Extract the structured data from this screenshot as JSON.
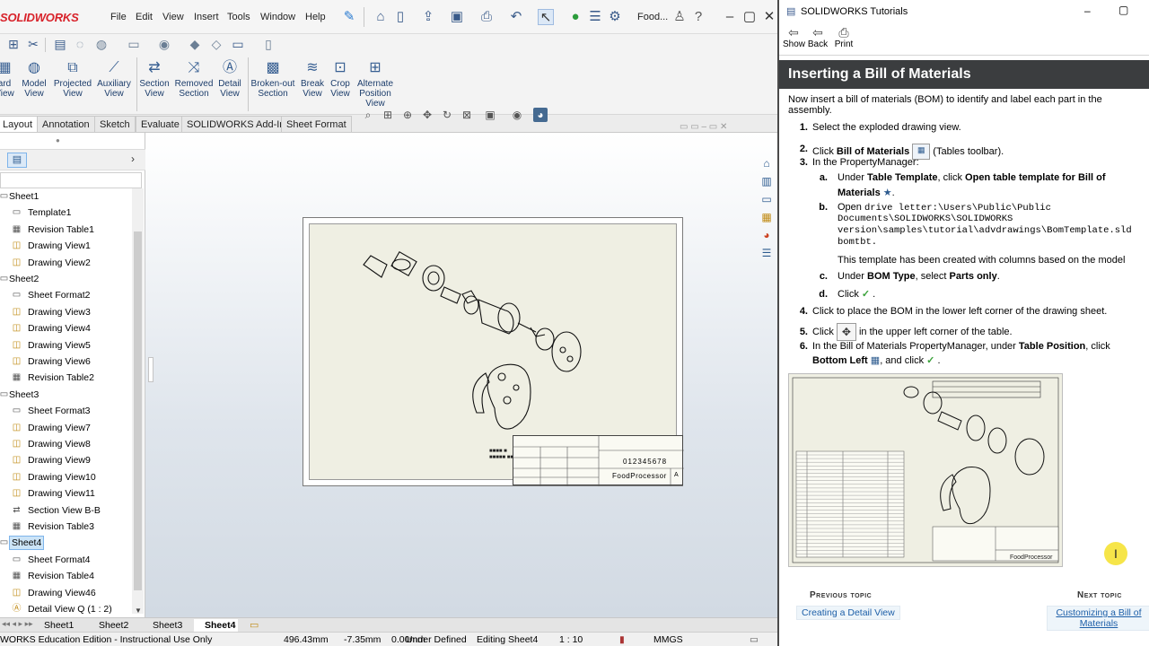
{
  "sw": {
    "logo": "SOLIDWORKS",
    "menus": [
      "File",
      "Edit",
      "View",
      "Insert",
      "Tools",
      "Window",
      "Help"
    ],
    "doc_title": "Food...",
    "ribbon": [
      {
        "label": "ard\nView",
        "icon": "standard-3-view-icon"
      },
      {
        "label": "Model\nView",
        "icon": "model-view-icon"
      },
      {
        "label": "Projected\nView",
        "icon": "projected-view-icon"
      },
      {
        "label": "Auxiliary\nView",
        "icon": "auxiliary-view-icon"
      },
      {
        "label": "Section\nView",
        "icon": "section-view-icon"
      },
      {
        "label": "Removed\nSection",
        "icon": "removed-section-icon"
      },
      {
        "label": "Detail\nView",
        "icon": "detail-view-icon"
      },
      {
        "label": "Broken-out\nSection",
        "icon": "broken-out-section-icon"
      },
      {
        "label": "Break\nView",
        "icon": "break-view-icon"
      },
      {
        "label": "Crop\nView",
        "icon": "crop-view-icon"
      },
      {
        "label": "Alternate\nPosition\nView",
        "icon": "alternate-position-view-icon"
      }
    ],
    "tabs": [
      "Layout",
      "Annotation",
      "Sketch",
      "Evaluate",
      "SOLIDWORKS Add-Ins",
      "Sheet Format"
    ],
    "tree": [
      {
        "label": "Sheet1",
        "level": 0,
        "icon": "sheet-icon"
      },
      {
        "label": "Template1",
        "level": 1,
        "icon": "sheet-format-icon"
      },
      {
        "label": "Revision Table1",
        "level": 1,
        "icon": "revision-table-icon"
      },
      {
        "label": "Drawing View1",
        "level": 1,
        "icon": "drawing-view-icon"
      },
      {
        "label": "Drawing View2",
        "level": 1,
        "icon": "drawing-view-icon"
      },
      {
        "label": "Sheet2",
        "level": 0,
        "icon": "sheet-icon"
      },
      {
        "label": "Sheet Format2",
        "level": 1,
        "icon": "sheet-format-icon"
      },
      {
        "label": "Drawing View3",
        "level": 1,
        "icon": "drawing-view-icon"
      },
      {
        "label": "Drawing View4",
        "level": 1,
        "icon": "drawing-view-icon"
      },
      {
        "label": "Drawing View5",
        "level": 1,
        "icon": "drawing-view-icon"
      },
      {
        "label": "Drawing View6",
        "level": 1,
        "icon": "drawing-view-icon"
      },
      {
        "label": "Revision Table2",
        "level": 1,
        "icon": "revision-table-icon"
      },
      {
        "label": "Sheet3",
        "level": 0,
        "icon": "sheet-icon"
      },
      {
        "label": "Sheet Format3",
        "level": 1,
        "icon": "sheet-format-icon"
      },
      {
        "label": "Drawing View7",
        "level": 1,
        "icon": "drawing-view-icon"
      },
      {
        "label": "Drawing View8",
        "level": 1,
        "icon": "drawing-view-icon"
      },
      {
        "label": "Drawing View9",
        "level": 1,
        "icon": "drawing-view-icon"
      },
      {
        "label": "Drawing View10",
        "level": 1,
        "icon": "drawing-view-icon"
      },
      {
        "label": "Drawing View11",
        "level": 1,
        "icon": "drawing-view-icon"
      },
      {
        "label": "Section View B-B",
        "level": 1,
        "icon": "section-view-icon"
      },
      {
        "label": "Revision Table3",
        "level": 1,
        "icon": "revision-table-icon"
      },
      {
        "label": "Sheet4",
        "level": 0,
        "icon": "sheet-icon",
        "selected": true
      },
      {
        "label": "Sheet Format4",
        "level": 1,
        "icon": "sheet-format-icon"
      },
      {
        "label": "Revision Table4",
        "level": 1,
        "icon": "revision-table-icon"
      },
      {
        "label": "Drawing View46",
        "level": 1,
        "icon": "drawing-view-icon"
      },
      {
        "label": "Detail View Q (1 : 2)",
        "level": 1,
        "icon": "detail-view-icon"
      }
    ],
    "title_block": {
      "part_no": "012345678",
      "name": "FoodProcessor",
      "size": "A"
    },
    "sheet_tabs": [
      "Sheet1",
      "Sheet2",
      "Sheet3",
      "Sheet4"
    ],
    "active_sheet": "Sheet4",
    "status": {
      "edition": "WORKS Education Edition - Instructional Use Only",
      "x": "496.43mm",
      "y": "-7.35mm",
      "z": "0.00mm",
      "state": "Under Defined",
      "editing": "Editing Sheet4",
      "scale": "1 : 10",
      "units": "MMGS"
    }
  },
  "tutorial": {
    "window_title": "SOLIDWORKS Tutorials",
    "tools": [
      "Show",
      "Back",
      "Print"
    ],
    "heading": "Inserting a Bill of Materials",
    "intro_1": "Now insert a bill of materials (BOM) to identify and label each part in the",
    "intro_2": "assembly.",
    "s1": "Select the exploded drawing view.",
    "s2_pre": "Click ",
    "s2_bold": "Bill of Materials",
    "s2_post": " (Tables toolbar).",
    "s3": "In the PropertyManager:",
    "s3a_pre": "Under ",
    "s3a_bold1": "Table Template",
    "s3a_mid": ", click ",
    "s3a_bold2": "Open table template for Bill of",
    "s3a_bold3": "Materials",
    "s3b_pre": "Open ",
    "s3b_l1": "drive letter:\\Users\\Public\\Public",
    "s3b_l2": "Documents\\SOLIDWORKS\\SOLIDWORKS",
    "s3b_l3": "version\\samples\\tutorial\\advdrawings\\BomTemplate.sld",
    "s3b_l4": "bomtbt.",
    "s3b_note": "This template has been created with columns based on the model",
    "s3c_pre": "Under ",
    "s3c_bold1": "BOM Type",
    "s3c_mid": ", select ",
    "s3c_bold2": "Parts only",
    "s3c_post": ".",
    "s3d": "Click",
    "s4": "Click to place the BOM in the lower left corner of the drawing sheet.",
    "s5_pre": "Click",
    "s5_post": "in the upper left corner of the table.",
    "s6_l1_pre": "In the Bill of Materials PropertyManager, under ",
    "s6_l1_bold": "Table Position",
    "s6_l1_post": ", click",
    "s6_l2_bold": "Bottom Left",
    "s6_l2_post": ", and click",
    "prev_label": "Previous topic",
    "prev_link": "Creating a Detail View",
    "next_label": "Next topic",
    "next_link_1": "Customizing a Bill of",
    "next_link_2": "Materials"
  }
}
